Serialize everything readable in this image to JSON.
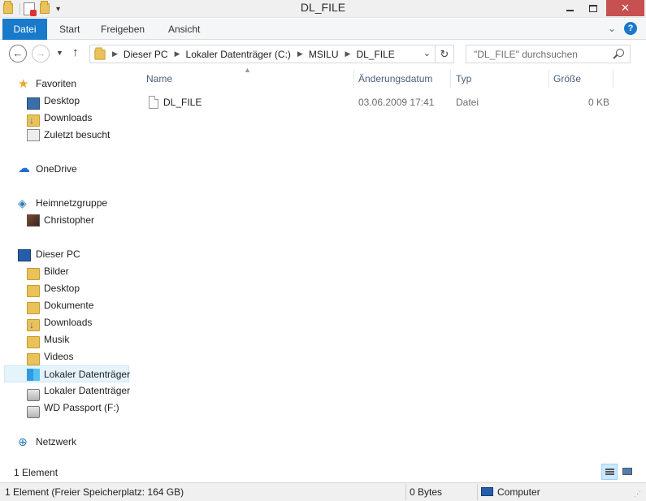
{
  "window": {
    "title": "DL_FILE",
    "controls": {
      "minimize": "minimize",
      "maximize": "maximize",
      "close": "✕"
    }
  },
  "ribbon": {
    "tabs": [
      {
        "label": "Datei",
        "active": true
      },
      {
        "label": "Start"
      },
      {
        "label": "Freigeben"
      },
      {
        "label": "Ansicht"
      }
    ],
    "expand_icon": "chevron-down-icon",
    "help_label": "?"
  },
  "navigation": {
    "back_icon": "arrow-left-icon",
    "forward_icon": "arrow-right-icon",
    "up_icon": "arrow-up-icon",
    "breadcrumb": [
      "Dieser PC",
      "Lokaler Datenträger (C:)",
      "MSILU",
      "DL_FILE"
    ],
    "search_placeholder": "\"DL_FILE\" durchsuchen"
  },
  "sidebar": {
    "favorites": {
      "label": "Favoriten",
      "items": [
        "Desktop",
        "Downloads",
        "Zuletzt besucht"
      ]
    },
    "onedrive": {
      "label": "OneDrive"
    },
    "homegroup": {
      "label": "Heimnetzgruppe",
      "items": [
        "Christopher"
      ]
    },
    "this_pc": {
      "label": "Dieser PC",
      "items": [
        "Bilder",
        "Desktop",
        "Dokumente",
        "Downloads",
        "Musik",
        "Videos",
        "Lokaler Datenträger",
        "Lokaler Datenträger",
        "WD Passport (F:)"
      ],
      "selected_index": 6
    },
    "network": {
      "label": "Netzwerk"
    }
  },
  "file_list": {
    "columns": [
      "Name",
      "Änderungsdatum",
      "Typ",
      "Größe"
    ],
    "sort_column": "Name",
    "rows": [
      {
        "name": "DL_FILE",
        "modified": "03.06.2009 17:41",
        "type": "Datei",
        "size": "0 KB"
      }
    ]
  },
  "item_count": "1 Element",
  "statusbar": {
    "left": "1 Element (Freier Speicherplatz: 164 GB)",
    "size": "0 Bytes",
    "location": "Computer"
  },
  "colors": {
    "file_tab": "#1979ca",
    "selection": "#e5f3fb",
    "close_button": "#c75050"
  }
}
